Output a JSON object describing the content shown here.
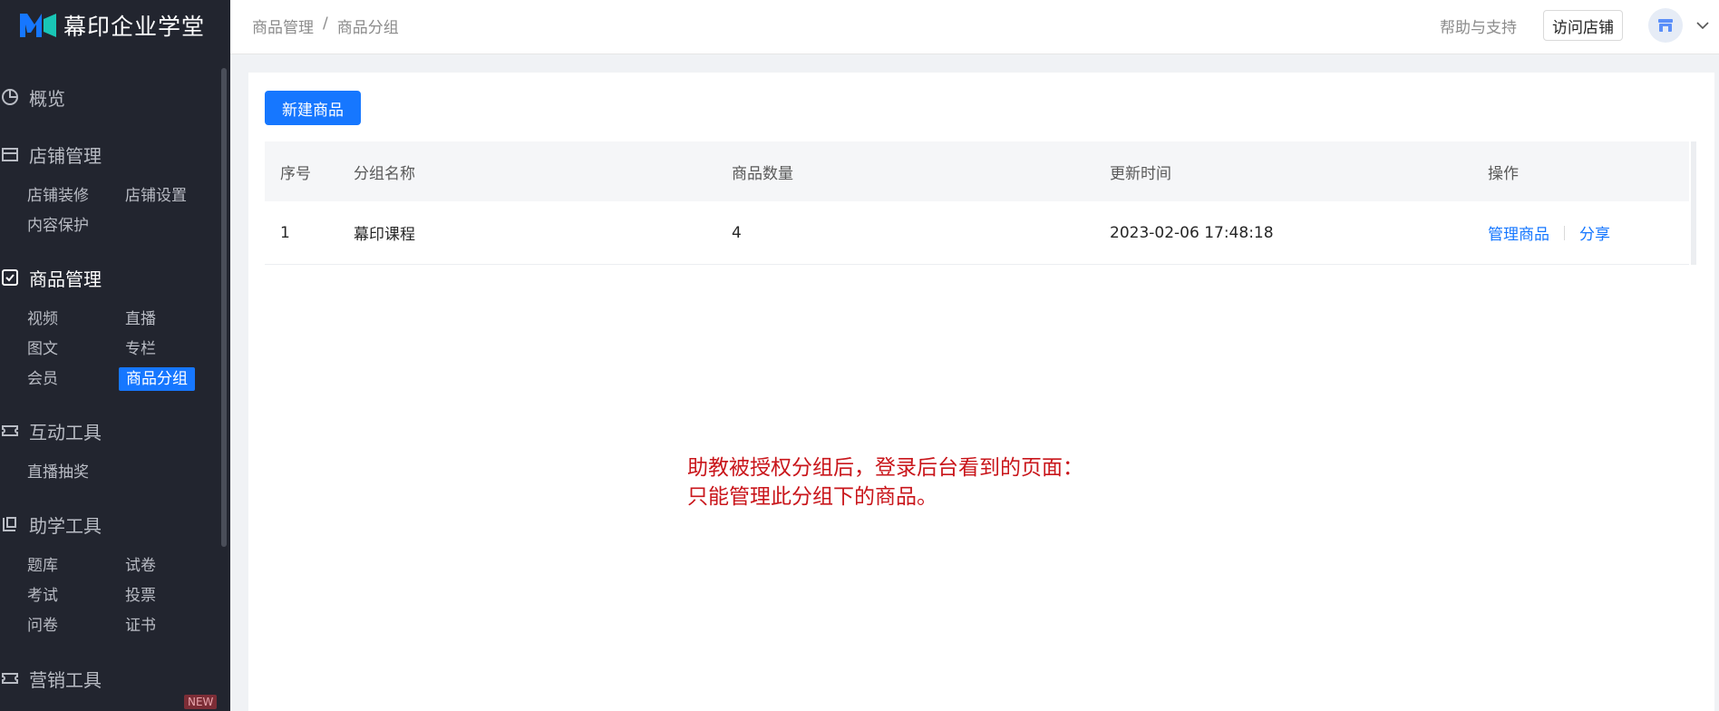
{
  "app": {
    "name": "幕印企业学堂"
  },
  "sidebar": {
    "sections": [
      {
        "label": "概览",
        "icon": "pie-chart-icon"
      },
      {
        "label": "店铺管理",
        "icon": "shop-icon",
        "items": [
          "店铺装修",
          "店铺设置",
          "内容保护"
        ]
      },
      {
        "label": "商品管理",
        "icon": "checklist-icon",
        "active": true,
        "items": [
          "视频",
          "直播",
          "图文",
          "专栏",
          "会员",
          "商品分组"
        ]
      },
      {
        "label": "互动工具",
        "icon": "ticket-icon",
        "items": [
          "直播抽奖"
        ]
      },
      {
        "label": "助学工具",
        "icon": "book-icon",
        "items": [
          "题库",
          "试卷",
          "考试",
          "投票",
          "问卷",
          "证书"
        ]
      },
      {
        "label": "营销工具",
        "icon": "coupon-icon",
        "badge": "NEW"
      }
    ],
    "active_item": "商品分组"
  },
  "header": {
    "breadcrumb": [
      "商品管理",
      "/",
      "商品分组"
    ],
    "help": "帮助与支持",
    "visit_store": "访问店铺"
  },
  "main": {
    "new_button": "新建商品",
    "table": {
      "columns": [
        "序号",
        "分组名称",
        "商品数量",
        "更新时间",
        "操作"
      ],
      "rows": [
        {
          "index": "1",
          "name": "幕印课程",
          "count": "4",
          "updated": "2023-02-06 17:48:18",
          "actions": [
            "管理商品",
            "分享"
          ]
        }
      ]
    }
  },
  "annotation": {
    "line1": "助教被授权分组后，登录后台看到的页面：",
    "line2": "只能管理此分组下的商品。"
  },
  "colors": {
    "sidebar_bg": "#22252f",
    "primary": "#1677ff",
    "annotation": "#c9161b"
  }
}
